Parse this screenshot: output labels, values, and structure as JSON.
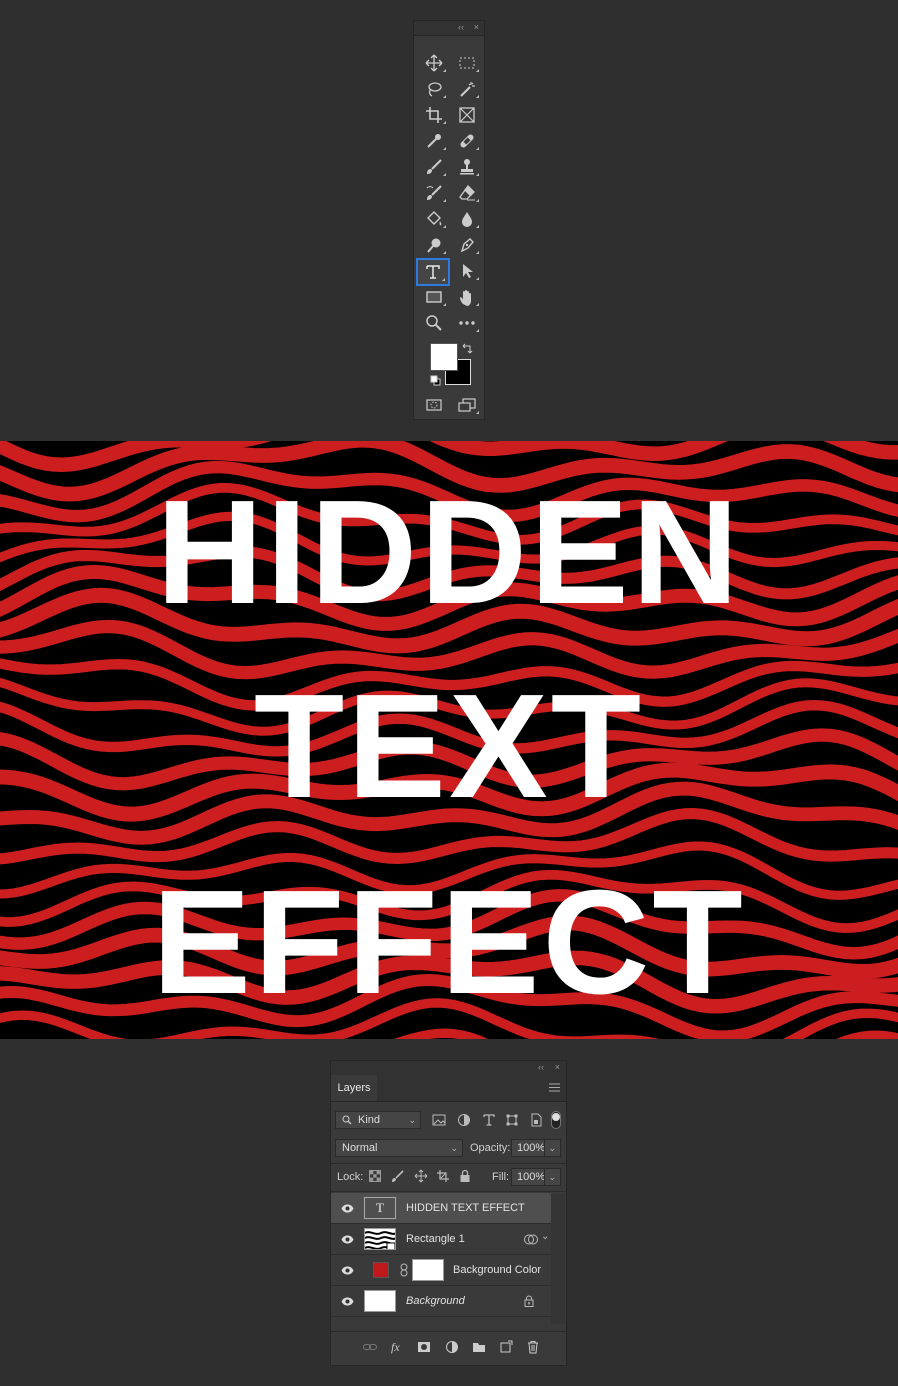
{
  "toolbar": {
    "collapse_glyph": "‹‹",
    "close_glyph": "×",
    "tools": [
      {
        "name": "move-tool",
        "icon": "move-icon"
      },
      {
        "name": "marquee-tool",
        "icon": "marquee-icon"
      },
      {
        "name": "lasso-tool",
        "icon": "lasso-icon"
      },
      {
        "name": "magic-wand-tool",
        "icon": "magic-wand-icon"
      },
      {
        "name": "crop-tool",
        "icon": "crop-icon"
      },
      {
        "name": "frame-tool",
        "icon": "frame-icon"
      },
      {
        "name": "eyedropper-tool",
        "icon": "eyedropper-icon"
      },
      {
        "name": "healing-tool",
        "icon": "bandage-icon"
      },
      {
        "name": "brush-tool",
        "icon": "brush-icon"
      },
      {
        "name": "stamp-tool",
        "icon": "stamp-icon"
      },
      {
        "name": "history-brush-tool",
        "icon": "history-brush-icon"
      },
      {
        "name": "eraser-tool",
        "icon": "eraser-icon"
      },
      {
        "name": "paint-bucket-tool",
        "icon": "paint-bucket-icon"
      },
      {
        "name": "blur-tool",
        "icon": "drop-icon"
      },
      {
        "name": "dodge-tool",
        "icon": "dodge-icon"
      },
      {
        "name": "pen-tool",
        "icon": "pen-icon"
      },
      {
        "name": "type-tool",
        "icon": "type-icon",
        "active": true
      },
      {
        "name": "path-selection-tool",
        "icon": "arrow-icon"
      },
      {
        "name": "rectangle-tool",
        "icon": "rectangle-icon"
      },
      {
        "name": "hand-tool",
        "icon": "hand-icon"
      },
      {
        "name": "zoom-tool",
        "icon": "zoom-icon"
      },
      {
        "name": "more-tools",
        "icon": "more-icon"
      }
    ],
    "foreground_color": "#ffffff",
    "background_color": "#000000"
  },
  "canvas": {
    "lines": [
      "HIDDEN",
      "TEXT",
      "EFFECT"
    ],
    "stripe_color": "#cc1e1e",
    "background": "#000000",
    "text_color": "#ffffff"
  },
  "layers_panel": {
    "collapse_glyph": "‹‹",
    "close_glyph": "×",
    "tab": "Layers",
    "filter": {
      "label": "Kind"
    },
    "blend_mode": "Normal",
    "opacity_label": "Opacity:",
    "opacity_value": "100%",
    "lock_label": "Lock:",
    "fill_label": "Fill:",
    "fill_value": "100%",
    "type_thumb_glyph": "T",
    "layers": [
      {
        "name": "HIDDEN TEXT EFFECT",
        "kind": "text",
        "selected": true
      },
      {
        "name": "Rectangle 1",
        "kind": "smart"
      },
      {
        "name": "Background Color",
        "kind": "fill",
        "swatch": "#c0191b"
      },
      {
        "name": "Background",
        "kind": "background",
        "italic": true
      }
    ]
  }
}
